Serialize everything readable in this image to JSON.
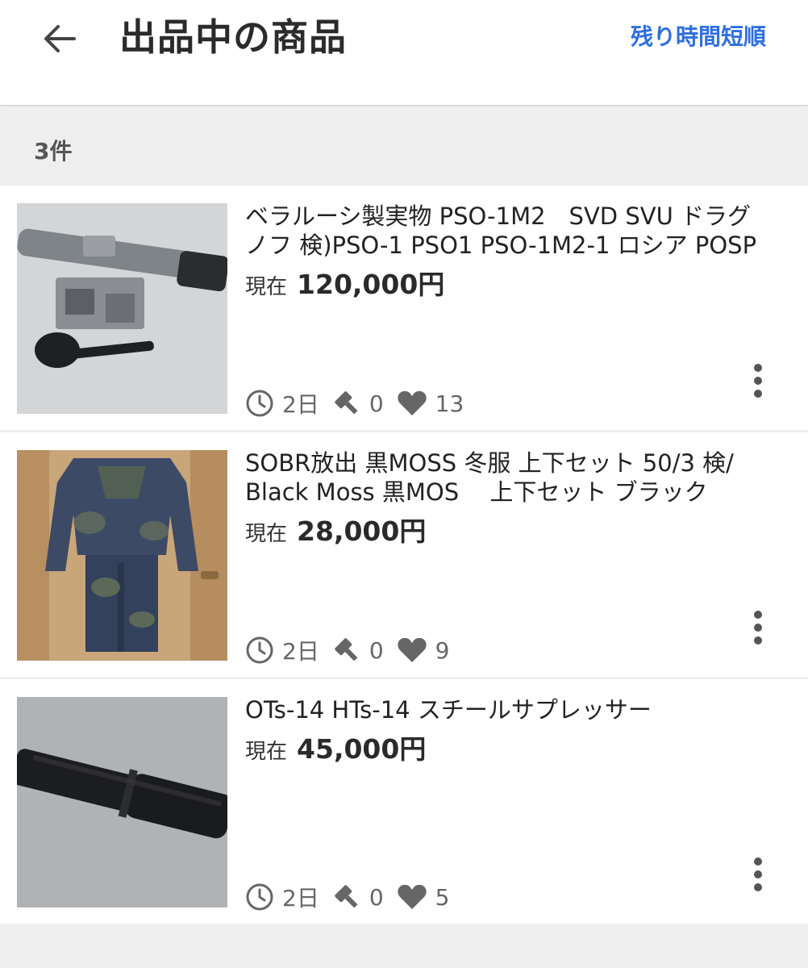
{
  "header": {
    "title": "出品中の商品",
    "sort_label": "残り時間短順"
  },
  "count_label": "3件",
  "price_prefix": "現在",
  "items": [
    {
      "title": "ベラルーシ製実物 PSO-1M2　SVD SVU ドラグノフ 検)PSO-1 PSO1 PSO-1M2-1 ロシア POSP",
      "price": "120,000円",
      "time_left": "2日",
      "bids": "0",
      "likes": "13"
    },
    {
      "title": "SOBR放出 黒MOSS 冬服 上下セット 50/3 検/ Black Moss 黒MOS　 上下セット ブラック",
      "price": "28,000円",
      "time_left": "2日",
      "bids": "0",
      "likes": "9"
    },
    {
      "title": "OTs-14 HTs-14 スチールサプレッサー",
      "price": "45,000円",
      "time_left": "2日",
      "bids": "0",
      "likes": "5"
    }
  ],
  "icons": {
    "back": "arrow-left-icon",
    "clock": "clock-icon",
    "bid": "gavel-icon",
    "like": "heart-icon",
    "more": "more-vertical-icon"
  },
  "colors": {
    "accent": "#2f6fdc",
    "background": "#efefef"
  }
}
